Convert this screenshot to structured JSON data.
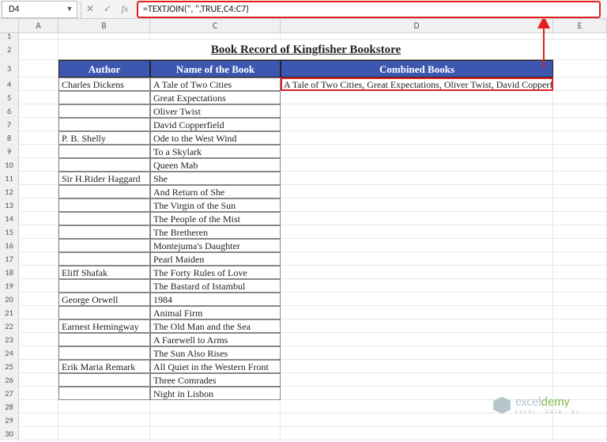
{
  "name_box": "D4",
  "formula": "=TEXTJOIN(\", \",TRUE,C4:C7)",
  "columns": [
    "A",
    "B",
    "C",
    "D",
    "E"
  ],
  "row_numbers": [
    1,
    2,
    3,
    4,
    5,
    6,
    7,
    8,
    9,
    10,
    11,
    12,
    13,
    14,
    15,
    16,
    17,
    18,
    19,
    20,
    21,
    22,
    23,
    24,
    25,
    26,
    27,
    28,
    29,
    30
  ],
  "title": "Book Record of Kingfisher Bookstore",
  "headers": {
    "author": "Author",
    "book": "Name of the Book",
    "combined": "Combined Books"
  },
  "rows": [
    {
      "author": "Charles Dickens",
      "book": "A Tale of Two Cities"
    },
    {
      "author": "",
      "book": "Great Expectations"
    },
    {
      "author": "",
      "book": "Oliver Twist"
    },
    {
      "author": "",
      "book": "David Copperfield"
    },
    {
      "author": "P. B. Shelly",
      "book": "Ode to the West Wind"
    },
    {
      "author": "",
      "book": "To a Skylark"
    },
    {
      "author": "",
      "book": "Queen Mab"
    },
    {
      "author": "Sir H.Rider Haggard",
      "book": "She"
    },
    {
      "author": "",
      "book": "And Return of She"
    },
    {
      "author": "",
      "book": "The Virgin of the Sun"
    },
    {
      "author": "",
      "book": "The People of the Mist"
    },
    {
      "author": "",
      "book": "The Bretheren"
    },
    {
      "author": "",
      "book": "Montejuma's Daughter"
    },
    {
      "author": "",
      "book": "Pearl Maiden"
    },
    {
      "author": "Eliff Shafak",
      "book": "The Forty Rules of Love"
    },
    {
      "author": "",
      "book": "The Bastard of Istambul"
    },
    {
      "author": "George Orwell",
      "book": "1984"
    },
    {
      "author": "",
      "book": "Animal Firm"
    },
    {
      "author": "Earnest Hemingway",
      "book": "The Old Man and the Sea"
    },
    {
      "author": "",
      "book": "A Farewell to Arms"
    },
    {
      "author": "",
      "book": "The Sun Also Rises"
    },
    {
      "author": "Erik Maria Remark",
      "book": "All Quiet in the Western Front"
    },
    {
      "author": "",
      "book": "Three Comrades"
    },
    {
      "author": "",
      "book": "Night in Lisbon"
    }
  ],
  "combined_value": "A Tale of Two Cities, Great Expectations, Oliver Twist, David Copperfield",
  "watermark": {
    "brand_a": "excel",
    "brand_b": "demy",
    "tagline": "EXCEL · DATA · BI"
  },
  "icons": {
    "fx": "fx",
    "cancel": "✕",
    "enter": "✓",
    "dropdown": "▼"
  }
}
